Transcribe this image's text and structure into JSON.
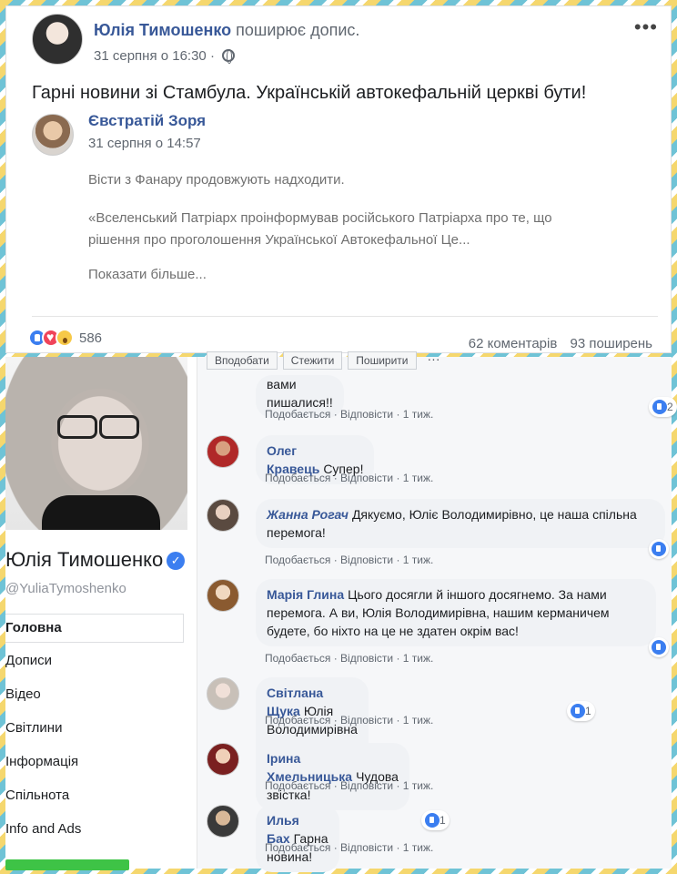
{
  "post": {
    "author": "Юлія Тимошенко",
    "action": "поширює допис.",
    "time": "31 серпня о 16:30 ·",
    "text": "Гарні новини зі Стамбула. Українській автокефальній церкві бути!",
    "shared": {
      "author": "Євстратій Зоря",
      "time": "31 серпня о 14:57",
      "line1": "Вісти з Фанару продовжують надходити.",
      "line2": "«Вселенський Патріарх проінформував російського Патріарха про те, що",
      "line3": "рішення про проголошення Української Автокефальної Це...",
      "show_more": "Показати більше..."
    },
    "reactions": {
      "count": "586",
      "icons": [
        "like-icon",
        "love-icon",
        "wow-icon"
      ]
    },
    "comments_count": "62 коментарів",
    "shares_count": "93 поширень"
  },
  "profile": {
    "name": "Юлія Тимошенко",
    "handle": "@YuliaTymoshenko",
    "nav": [
      "Головна",
      "Дописи",
      "Відео",
      "Світлини",
      "Інформація",
      "Спільнота",
      "Info and Ads"
    ]
  },
  "action_bar": [
    "Вподобати",
    "Стежити",
    "Поширити",
    "···"
  ],
  "comment_meta": {
    "like": "Подобається",
    "reply": "Відповісти",
    "age": "1 тиж."
  },
  "comments": [
    {
      "author": "",
      "text": "вами пишалися!!",
      "reacts": "2"
    },
    {
      "author": "Олег Кравець",
      "text": "Супер!",
      "reacts": ""
    },
    {
      "author": "Жанна Рогач",
      "text": "Дякуємо, Юліє Володимирівно, це наша спільна перемога!",
      "reacts": ""
    },
    {
      "author": "Марія Глина",
      "text": "Цього досягли й іншого досягнемо. За нами перемога. А ви, Юлія Володимирівна, нашим керманичем будете, бо ніхто на це не здатен окрім вас!",
      "reacts": ""
    },
    {
      "author": "Світлана Щука",
      "text": "Юлія Володимирівна - ви наш президент!",
      "reacts": "1"
    },
    {
      "author": "Ірина Хмельницька",
      "text": "Чудова звістка!",
      "reacts": ""
    },
    {
      "author": "Илья Бах",
      "text": "Гарна новина!",
      "reacts": "1"
    }
  ],
  "colors": {
    "link": "#385898",
    "like": "#3b7ef0",
    "love": "#f0445a",
    "frame_yellow": "#f5d76e",
    "frame_blue": "#6fc3d6"
  }
}
